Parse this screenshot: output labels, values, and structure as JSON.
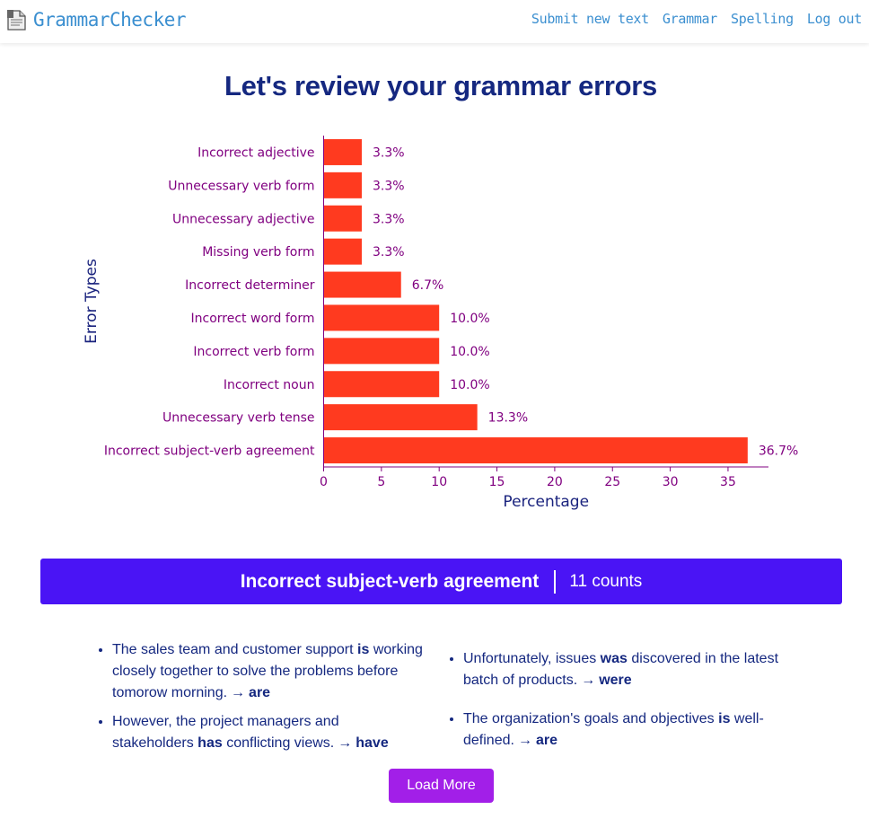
{
  "navbar": {
    "brand": "GrammarChecker",
    "logo_icon": "document-icon",
    "links": [
      "Submit new text",
      "Grammar",
      "Spelling",
      "Log out"
    ]
  },
  "page": {
    "title": "Let's review your grammar errors"
  },
  "chart_data": {
    "type": "bar",
    "orientation": "horizontal",
    "categories": [
      "Incorrect adjective",
      "Unnecessary verb form",
      "Unnecessary adjective",
      "Missing verb form",
      "Incorrect determiner",
      "Incorrect word form",
      "Incorrect verb form",
      "Incorrect noun",
      "Unnecessary verb tense",
      "Incorrect subject-verb agreement"
    ],
    "values": [
      3.3,
      3.3,
      3.3,
      3.3,
      6.7,
      10.0,
      10.0,
      10.0,
      13.3,
      36.7
    ],
    "value_labels": [
      "3.3%",
      "3.3%",
      "3.3%",
      "3.3%",
      "6.7%",
      "10.0%",
      "10.0%",
      "10.0%",
      "13.3%",
      "36.7%"
    ],
    "xlabel": "Percentage",
    "ylabel": "Error Types",
    "xlim": [
      0,
      38.5
    ],
    "xticks": [
      0,
      5,
      10,
      15,
      20,
      25,
      30,
      35
    ],
    "grid": false,
    "bar_color": "#ff3a1f",
    "text_color": "#800080",
    "axis_label_color": "#1a237e"
  },
  "banner": {
    "title": "Incorrect subject-verb agreement",
    "count": "11 counts"
  },
  "examples": {
    "left": [
      {
        "before": "The sales team and customer support ",
        "error": "is",
        "after": " working closely together to solve the problems before tomorow morning.",
        "arrow": "→",
        "fix": "are"
      },
      {
        "before": "However, the project managers and stakeholders ",
        "error": "has",
        "after": " conflicting views.",
        "arrow": "→",
        "fix": "have"
      }
    ],
    "right": [
      {
        "before": "Unfortunately, issues ",
        "error": "was",
        "after": " discovered in the latest batch of products.",
        "arrow": "→",
        "fix": "were"
      },
      {
        "before": "The organization's goals and objectives ",
        "error": "is",
        "after": " well-defined.",
        "arrow": "→",
        "fix": "are"
      }
    ]
  },
  "load_more": {
    "label": "Load More"
  },
  "colors": {
    "brand": "#3b8fd0",
    "title": "#152880",
    "banner": "#4a14f5",
    "button": "#a21fe8"
  }
}
